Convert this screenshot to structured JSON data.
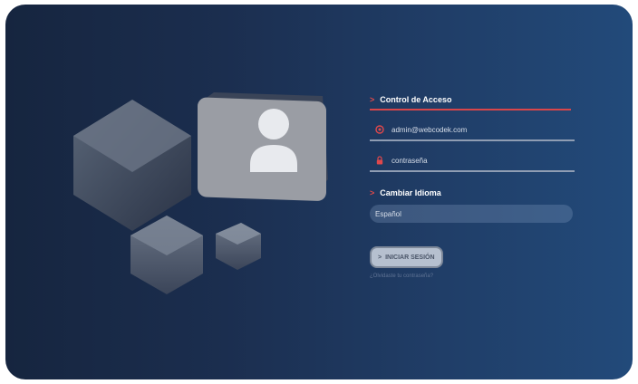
{
  "access": {
    "title": "Control de Acceso"
  },
  "fields": {
    "email": {
      "value": "admin@webcodek.com",
      "icon": "at-icon"
    },
    "password": {
      "value": "contraseña",
      "icon": "lock-icon"
    }
  },
  "language": {
    "title": "Cambiar Idioma",
    "selected": "Español"
  },
  "login": {
    "label": "INICIAR SESIÓN",
    "icon": "chevron-right-icon"
  },
  "forgot": {
    "label": "¿Olvidaste tu contraseña?"
  },
  "colors": {
    "accent": "#d9464a",
    "background_start": "#16253f",
    "background_end": "#224a7a"
  }
}
